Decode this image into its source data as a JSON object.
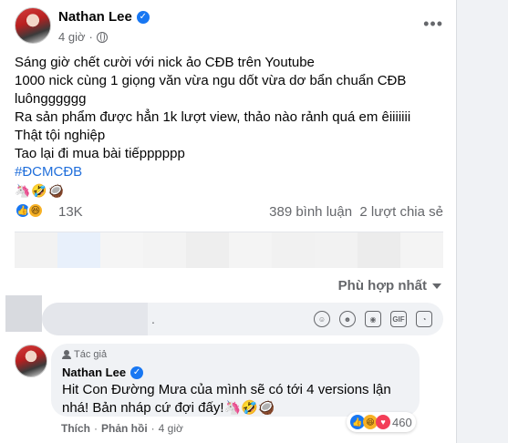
{
  "post": {
    "author": "Nathan Lee",
    "time": "4 giờ",
    "more_label": "•••",
    "lines": [
      "Sáng giờ chết cười với nick ảo CĐB trên Youtube",
      "1000 nick cùng 1 giọng văn vừa ngu dốt vừa dơ bẩn chuẩn CĐB",
      "luôngggggg",
      "Ra sản phẩm được hẳn 1k lượt view, thảo nào rảnh quá em êiiiiiii",
      "Thật tội nghiệp",
      "Tao lại đi mua bài tiếpppppp"
    ],
    "hashtag": "#ĐCMCĐB",
    "emojis": "🦄🤣🥥"
  },
  "reactions": {
    "count": "13K",
    "comments": "389 bình luận",
    "shares": "2 lượt chia sẻ"
  },
  "sort_label": "Phù hợp nhất",
  "composer": {
    "placeholder": "."
  },
  "reply": {
    "badge": "Tác giả",
    "author": "Nathan Lee",
    "text_line1": "Hit Con Đường Mưa của mình sẽ có tới 4 versions lận",
    "text_line2": "nhá! Bản nháp cứ đợi đấy!",
    "text_emojis": "🦄🤣🥥",
    "react_count": "460",
    "like": "Thích",
    "reply": "Phản hồi",
    "sep": "·",
    "time": "4 giờ"
  },
  "colors": {
    "accent": "#1877f2",
    "hashtag": "#216fdb",
    "secondary_text": "#65676b",
    "preview_strip": [
      "#f2f2f2",
      "#e8f0fb",
      "#f5f5f5",
      "#f3f3f3",
      "#eeeeee",
      "#f4f4f4",
      "#f1f1f1",
      "#f2f2f2",
      "#ececec",
      "#f4f4f4"
    ]
  }
}
